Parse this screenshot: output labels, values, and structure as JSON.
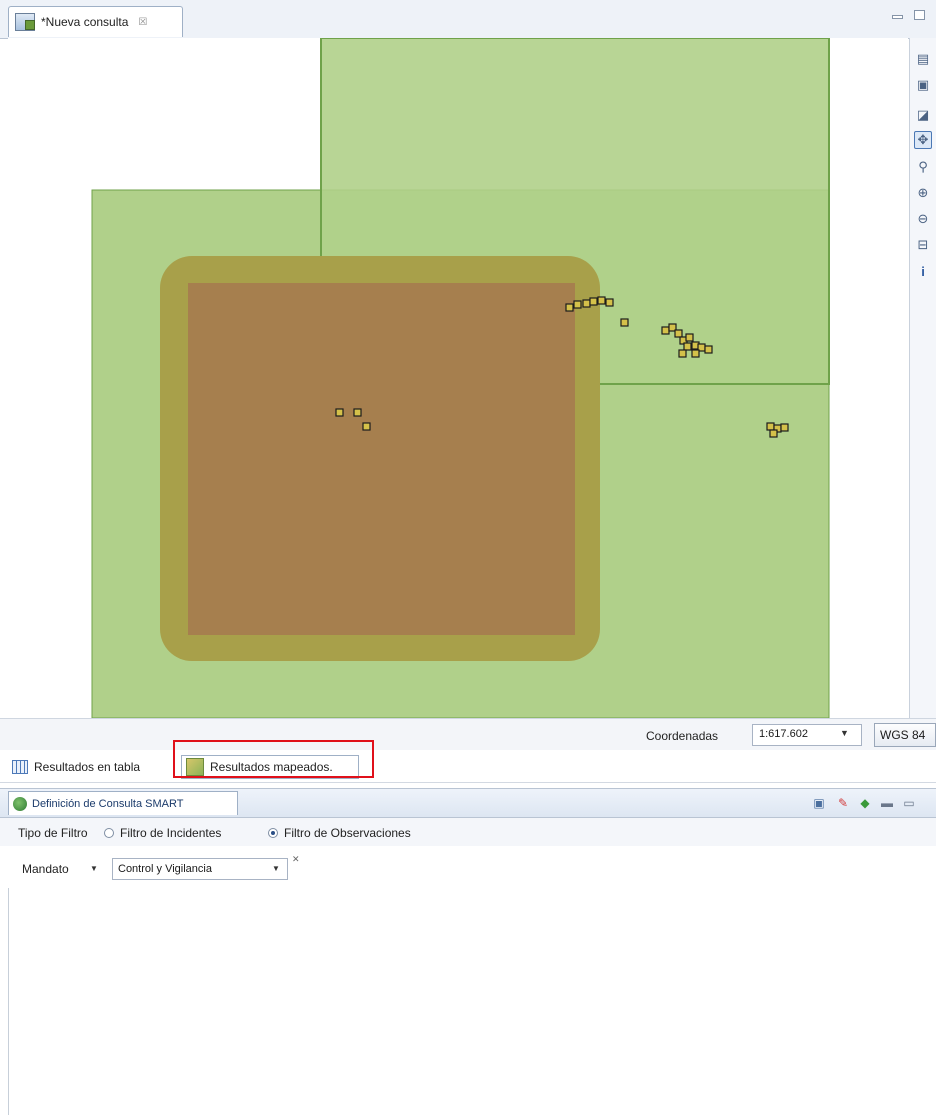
{
  "editor": {
    "tab_title": "*Nueva consulta",
    "tab_close": "☒"
  },
  "map": {
    "tools": [
      "layer-add-icon",
      "layer-icon",
      "style-icon",
      "pan-icon",
      "zoom-icon",
      "zoom-in-icon",
      "zoom-out-icon",
      "extent-icon",
      "info-icon"
    ],
    "colors": {
      "area_fill": "#b0d08a",
      "area_stroke": "#6fa24a",
      "buffer_fill": "#a8a04a",
      "core_fill": "#a67f4e",
      "marker_fill": "#d4c14a",
      "marker_stroke": "#1c1c1c"
    }
  },
  "status": {
    "coord_label": "Coordenadas",
    "scale": "1:617.602",
    "crs": "WGS 84"
  },
  "result_tabs": {
    "table_label": "Resultados en tabla",
    "map_label": "Resultados mapeados."
  },
  "definition": {
    "title": "Definición de Consulta SMART",
    "filter_type_label": "Tipo de Filtro",
    "filter_incidents": "Filtro de Incidentes",
    "filter_observations": "Filtro de Observaciones",
    "mandate_label": "Mandato",
    "mandate_value": "Control y Vigilancia"
  }
}
